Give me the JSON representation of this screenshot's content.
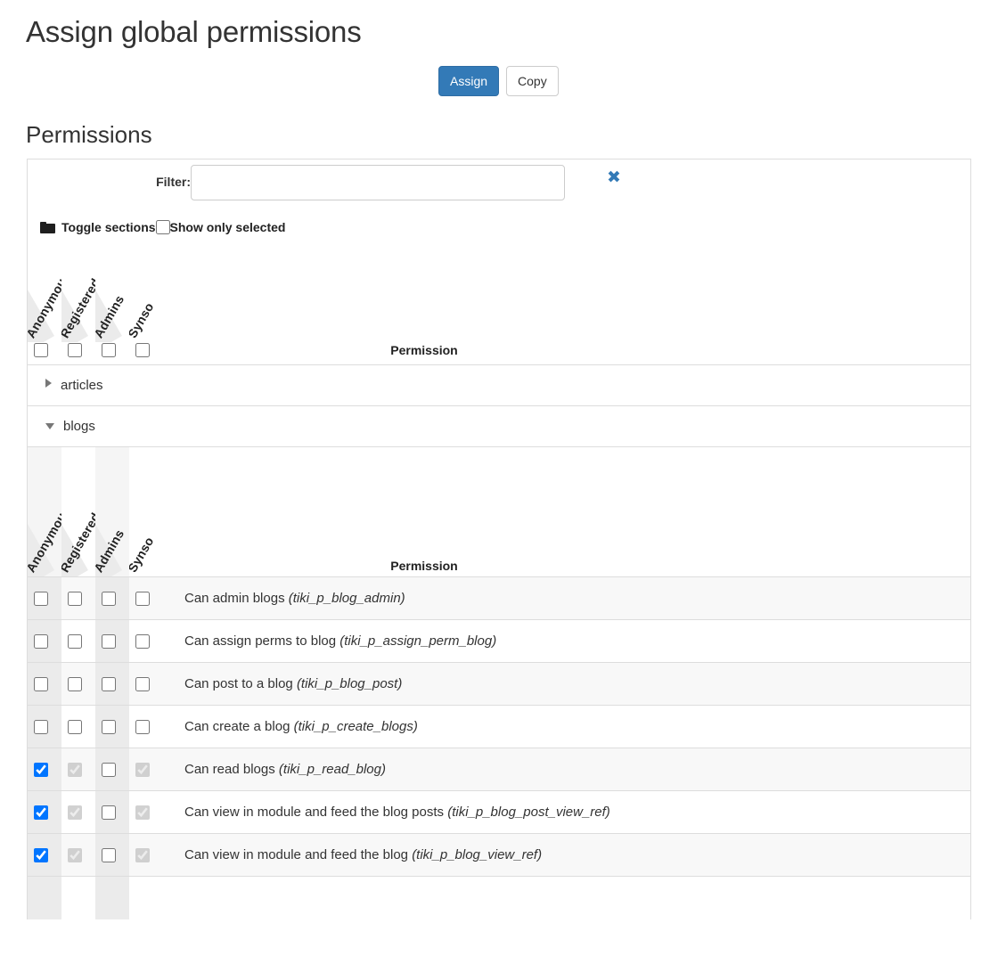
{
  "page": {
    "title": "Assign global permissions",
    "section_heading": "Permissions"
  },
  "toolbar": {
    "assign_label": "Assign",
    "copy_label": "Copy"
  },
  "filter": {
    "label": "Filter:",
    "value": "",
    "placeholder": "",
    "clear_icon": "✖"
  },
  "toggle": {
    "folder_icon": "folder-icon",
    "toggle_sections_label": "Toggle sections",
    "show_only_selected_label": "Show only selected",
    "show_only_selected_checked": false
  },
  "table": {
    "permission_column_header": "Permission",
    "groups": [
      "Anonymous",
      "Registered",
      "Admins",
      "Synso"
    ],
    "group_header_checkboxes": [
      false,
      false,
      false,
      false
    ]
  },
  "sections": [
    {
      "name": "articles",
      "expanded": false,
      "toggle_icon": "triangle-right-icon"
    },
    {
      "name": "blogs",
      "expanded": true,
      "toggle_icon": "triangle-down-icon",
      "groups": [
        "Anonymous",
        "Registered",
        "Admins",
        "Synso"
      ],
      "permission_column_header": "Permission",
      "group_header_checkboxes": [
        false,
        false,
        false,
        false
      ],
      "rows": [
        {
          "label": "Can admin blogs",
          "code": "(tiki_p_blog_admin)",
          "checks": [
            {
              "checked": false,
              "disabled": false
            },
            {
              "checked": false,
              "disabled": false
            },
            {
              "checked": false,
              "disabled": false
            },
            {
              "checked": false,
              "disabled": false
            }
          ]
        },
        {
          "label": "Can assign perms to blog",
          "code": "(tiki_p_assign_perm_blog)",
          "checks": [
            {
              "checked": false,
              "disabled": false
            },
            {
              "checked": false,
              "disabled": false
            },
            {
              "checked": false,
              "disabled": false
            },
            {
              "checked": false,
              "disabled": false
            }
          ]
        },
        {
          "label": "Can post to a blog",
          "code": "(tiki_p_blog_post)",
          "checks": [
            {
              "checked": false,
              "disabled": false
            },
            {
              "checked": false,
              "disabled": false
            },
            {
              "checked": false,
              "disabled": false
            },
            {
              "checked": false,
              "disabled": false
            }
          ]
        },
        {
          "label": "Can create a blog",
          "code": "(tiki_p_create_blogs)",
          "checks": [
            {
              "checked": false,
              "disabled": false
            },
            {
              "checked": false,
              "disabled": false
            },
            {
              "checked": false,
              "disabled": false
            },
            {
              "checked": false,
              "disabled": false
            }
          ]
        },
        {
          "label": "Can read blogs",
          "code": "(tiki_p_read_blog)",
          "checks": [
            {
              "checked": true,
              "disabled": false
            },
            {
              "checked": true,
              "disabled": true
            },
            {
              "checked": false,
              "disabled": false
            },
            {
              "checked": true,
              "disabled": true
            }
          ]
        },
        {
          "label": "Can view in module and feed the blog posts",
          "code": "(tiki_p_blog_post_view_ref)",
          "checks": [
            {
              "checked": true,
              "disabled": false
            },
            {
              "checked": true,
              "disabled": true
            },
            {
              "checked": false,
              "disabled": false
            },
            {
              "checked": true,
              "disabled": true
            }
          ]
        },
        {
          "label": "Can view in module and feed the blog",
          "code": "(tiki_p_blog_view_ref)",
          "checks": [
            {
              "checked": true,
              "disabled": false
            },
            {
              "checked": true,
              "disabled": true
            },
            {
              "checked": false,
              "disabled": false
            },
            {
              "checked": true,
              "disabled": true
            }
          ]
        }
      ]
    }
  ],
  "colors": {
    "primary": "#337ab7",
    "border": "#dddddd",
    "shade": "#ebebeb",
    "stripe": "#f8f8f8",
    "text": "#333333"
  }
}
